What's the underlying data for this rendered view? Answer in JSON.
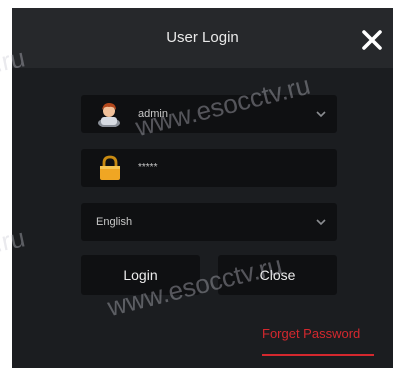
{
  "dialog": {
    "title": "User Login",
    "close_icon": "close-icon"
  },
  "username": {
    "icon": "user-avatar-icon",
    "value": "admin",
    "dropdown_icon": "chevron-down-icon"
  },
  "password": {
    "icon": "lock-icon",
    "value": "*****"
  },
  "language": {
    "selected": "English",
    "dropdown_icon": "chevron-down-icon"
  },
  "buttons": {
    "login_label": "Login",
    "close_label": "Close"
  },
  "forgot_password": {
    "label": "Forget Password"
  },
  "watermarks": {
    "text_full": "www.esocctv.ru",
    "text_partial": ".ru"
  },
  "colors": {
    "dialog_bg": "#1b1d20",
    "titlebar_bg": "#26282b",
    "field_bg": "#0f1012",
    "accent_red": "#d4282e"
  }
}
